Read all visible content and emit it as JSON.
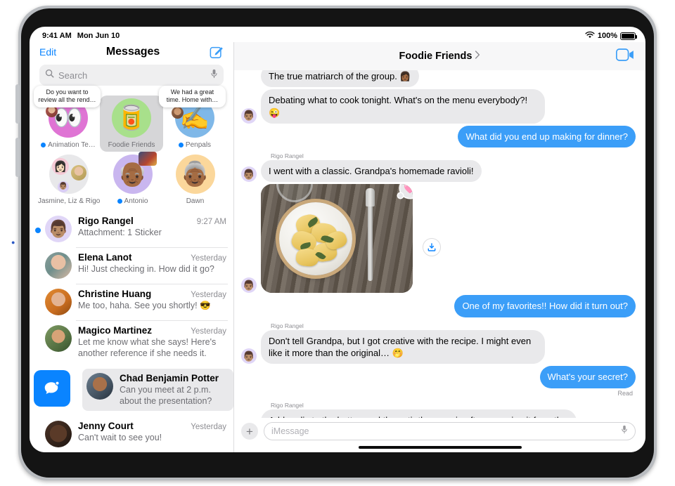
{
  "device": {
    "name": "iPad"
  },
  "status_bar": {
    "time": "9:41 AM",
    "date": "Mon Jun 10",
    "wifi_icon": "wifi-icon",
    "battery_percent": "100%",
    "battery_icon": "battery-full-icon",
    "multitask_icon": "multitasking-dots-icon"
  },
  "sidebar": {
    "edit_label": "Edit",
    "title": "Messages",
    "compose_icon": "compose-icon",
    "search": {
      "placeholder": "Search",
      "value": "",
      "search_icon": "search-icon",
      "mic_icon": "microphone-icon"
    },
    "pinned": [
      {
        "label": "Animation Te…",
        "unread": true,
        "emoji": "👀",
        "bg": "#df74d4",
        "preview": "Do you want to review all the rend…",
        "has_mini_avatar": true
      },
      {
        "label": "Foodie Friends",
        "unread": false,
        "emoji": "🥫",
        "bg": "#a8e08b",
        "selected": true,
        "preview": "",
        "has_mini_avatar": false
      },
      {
        "label": "Penpals",
        "unread": true,
        "emoji": "✍️",
        "bg": "#7fb8e8",
        "preview": "We had a great time. Home with…",
        "has_mini_avatar": true
      },
      {
        "label": "Jasmine, Liz & Rigo",
        "unread": false,
        "emoji": "",
        "bg": "#e8e8ea",
        "preview": "",
        "has_mini_avatar": false
      },
      {
        "label": "Antonio",
        "unread": true,
        "emoji": "👴🏾",
        "bg": "#c9b6ef",
        "preview": "",
        "has_mini_avatar": false
      },
      {
        "label": "Dawn",
        "unread": false,
        "emoji": "👵🏾",
        "bg": "#fbd79b",
        "preview": "",
        "has_mini_avatar": false
      }
    ],
    "conversations": [
      {
        "name": "Rigo Rangel",
        "time": "9:27 AM",
        "snippet": "Attachment: 1 Sticker",
        "unread": true,
        "avatar": "memoji-rigo",
        "avatar_emoji": "👨🏽",
        "avatar_bg": "#e0d6f7"
      },
      {
        "name": "Elena Lanot",
        "time": "Yesterday",
        "snippet": "Hi! Just checking in. How did it go?",
        "unread": false,
        "avatar": "photo-elena"
      },
      {
        "name": "Christine Huang",
        "time": "Yesterday",
        "snippet": "Me too, haha. See you shortly! 😎",
        "unread": false,
        "avatar": "photo-christine"
      },
      {
        "name": "Magico Martinez",
        "time": "Yesterday",
        "snippet": "Let me know what she says! Here's another reference if she needs it.",
        "unread": false,
        "avatar": "photo-magico"
      },
      {
        "name": "Chad Benjamin Potter",
        "time": "",
        "snippet": "Can you meet at 2 p.m. about the presentation?",
        "unread": false,
        "avatar": "photo-chad",
        "swiped": true,
        "swipe_action_icon": "mark-as-unread-icon"
      },
      {
        "name": "Jenny Court",
        "time": "Yesterday",
        "snippet": "Can't wait to see you!",
        "unread": false,
        "avatar": "photo-jenny"
      }
    ]
  },
  "conversation": {
    "title": "Foodie Friends",
    "title_chevron_icon": "chevron-right-icon",
    "facetime_icon": "facetime-video-icon",
    "messages": [
      {
        "id": "m0",
        "direction": "in",
        "sender": "",
        "text": "The true matriarch of the group. 👩🏾",
        "clipped": true,
        "show_avatar": false
      },
      {
        "id": "m1",
        "direction": "in",
        "sender": "",
        "text": "Debating what to cook tonight. What's on the menu everybody?! 😜",
        "show_avatar": true,
        "avatar_emoji": "👨🏽"
      },
      {
        "id": "m2",
        "direction": "out",
        "sender": "",
        "text": "What did you end up making for dinner?",
        "show_avatar": false
      },
      {
        "id": "m3",
        "direction": "in",
        "sender": "Rigo Rangel",
        "text": "I went with a classic. Grandpa's homemade ravioli!",
        "show_avatar": true,
        "avatar_emoji": "👨🏽"
      },
      {
        "id": "m4",
        "direction": "in",
        "type": "photo",
        "sender": "",
        "photo_alt": "Plate of ravioli with sage on a wooden table",
        "reaction": "🩷",
        "reaction_name": "heart-reaction",
        "save_icon": "save-to-photos-icon",
        "show_avatar": true,
        "avatar_emoji": "👨🏽"
      },
      {
        "id": "m5",
        "direction": "out",
        "sender": "",
        "text": "One of my favorites!! How did it turn out?",
        "show_avatar": false
      },
      {
        "id": "m6",
        "direction": "in",
        "sender": "Rigo Rangel",
        "text": "Don't tell Grandpa, but I got creative with the recipe. I might even like it more than the original… 🤭",
        "show_avatar": true,
        "avatar_emoji": "👨🏽"
      },
      {
        "id": "m7",
        "direction": "out",
        "sender": "",
        "text": "What's your secret?",
        "receipt": "Read",
        "show_avatar": false
      },
      {
        "id": "m8",
        "direction": "in",
        "sender": "Rigo Rangel",
        "text": "Add garlic to the butter, and then stir the sage in after removing it from the heat, while it's still hot. Top with pine nuts!",
        "show_avatar": true,
        "avatar_emoji": "👨🏽"
      }
    ],
    "input": {
      "placeholder": "iMessage",
      "value": "",
      "plus_icon": "plus-icon",
      "mic_icon": "microphone-icon"
    }
  },
  "colors": {
    "accent_blue": "#0a84ff",
    "outgoing_bubble": "#3b9ef8",
    "incoming_bubble": "#e9e9eb",
    "selected_row": "#e9e9eb",
    "secondary_text": "#8e8e93"
  }
}
